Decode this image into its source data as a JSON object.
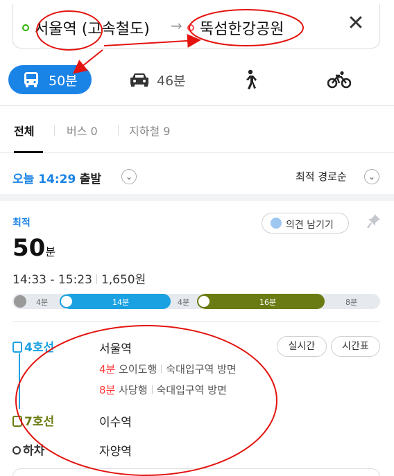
{
  "search": {
    "origin": "서울역 (고속철도)",
    "arrow": "→",
    "destination": "뚝섬한강공원",
    "close": "✕"
  },
  "modes": {
    "bus_time": "50분",
    "car_time": "46분"
  },
  "tabs": {
    "all": "전체",
    "bus": "버스 0",
    "subway": "지하철 9"
  },
  "depart": {
    "time": "오늘 14:29",
    "label": "출발",
    "sort": "최적 경로순"
  },
  "route": {
    "badge": "최적",
    "feedback": "의견 남기기",
    "duration_num": "50",
    "duration_unit": "분",
    "time_range": "14:33 - 15:23",
    "fare": "1,650원",
    "timeline": {
      "walk1": "4분",
      "bus": "14분",
      "walk2": "4분",
      "subway": "16분",
      "walk3": "8분"
    }
  },
  "steps": [
    {
      "line": "4호선",
      "station": "서울역",
      "arrivals": [
        {
          "min": "4분",
          "dest": "오이도행",
          "direction": "숙대입구역 방면"
        },
        {
          "min": "8분",
          "dest": "사당행",
          "direction": "숙대입구역 방면"
        }
      ]
    },
    {
      "line": "7호선",
      "station": "이수역"
    },
    {
      "line": "하차",
      "station": "자양역"
    }
  ],
  "buttons": {
    "realtime": "실시간",
    "timetable": "시간표"
  },
  "colors": {
    "accent": "#1a83e6",
    "line4": "#1aa1e2",
    "line7": "#6b7b13",
    "arrival_min": "#ff3b3b",
    "annotation": "#e3140f"
  }
}
